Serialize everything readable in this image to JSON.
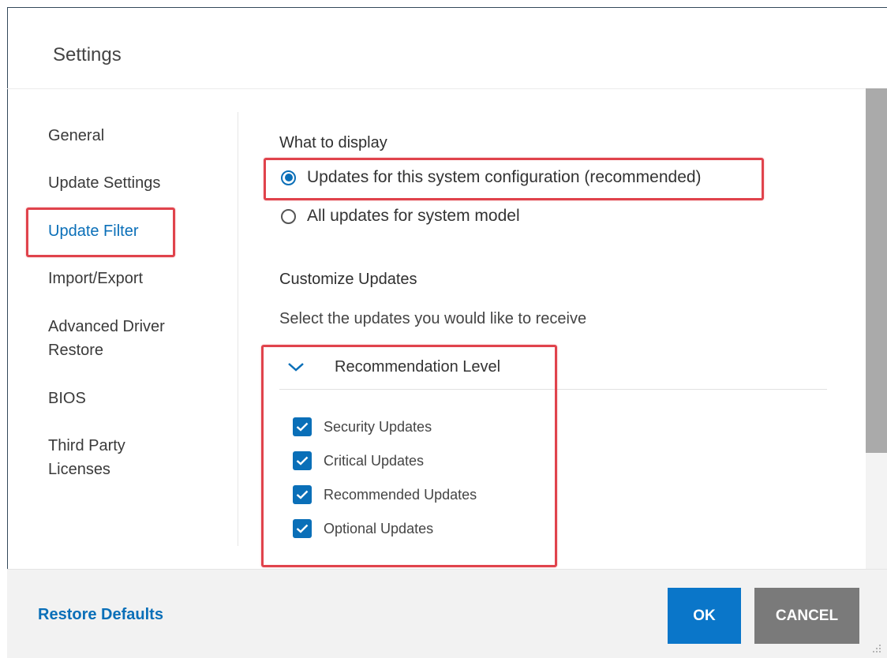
{
  "dialog": {
    "title": "Settings"
  },
  "nav": {
    "items": [
      {
        "label": "General"
      },
      {
        "label": "Update Settings"
      },
      {
        "label": "Update Filter"
      },
      {
        "label": "Import/Export"
      },
      {
        "label": "Advanced Driver Restore"
      },
      {
        "label": "BIOS"
      },
      {
        "label": "Third Party Licenses"
      }
    ],
    "active": "Update Filter"
  },
  "what_to_display": {
    "heading": "What to display",
    "options": [
      {
        "label": "Updates for this system configuration (recommended)",
        "selected": true
      },
      {
        "label": "All updates for system model",
        "selected": false
      }
    ]
  },
  "customize": {
    "heading": "Customize Updates",
    "description": "Select the updates you would like to receive",
    "group": {
      "title": "Recommendation Level",
      "expanded": true,
      "items": [
        {
          "label": "Security Updates",
          "checked": true
        },
        {
          "label": "Critical Updates",
          "checked": true
        },
        {
          "label": "Recommended Updates",
          "checked": true
        },
        {
          "label": "Optional Updates",
          "checked": true
        }
      ]
    }
  },
  "footer": {
    "restore_label": "Restore Defaults",
    "ok_label": "OK",
    "cancel_label": "CANCEL"
  },
  "colors": {
    "accent": "#0a6fb8",
    "highlight": "#e0434c",
    "cancel_button": "#7a7a7a"
  },
  "icons": [
    "chevron-down-icon",
    "check-icon",
    "resize-grip-icon"
  ]
}
